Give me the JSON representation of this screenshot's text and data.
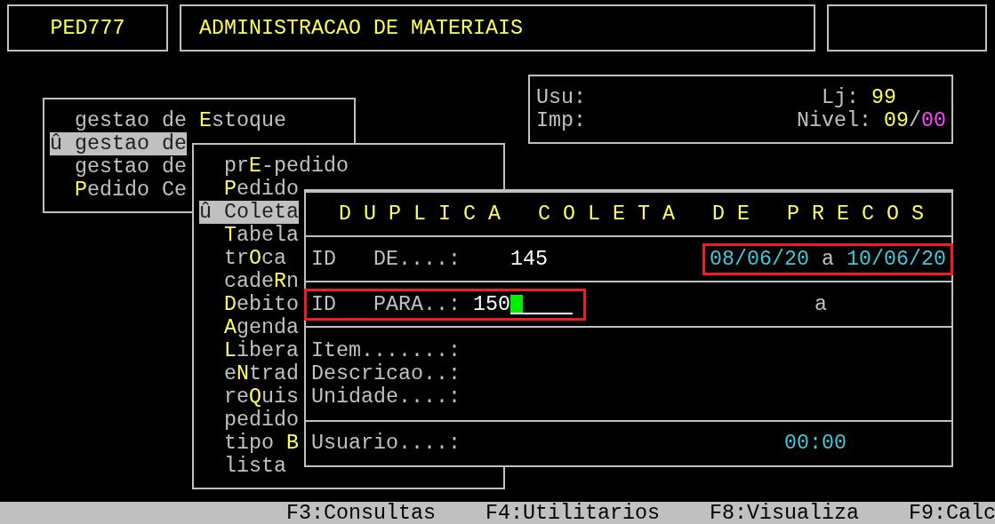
{
  "header": {
    "program_code": "PED777",
    "system_title": "ADMINISTRACAO DE MATERIAIS"
  },
  "info": {
    "user_label": "Usu:",
    "printer_label": "Imp:",
    "store_label": "Lj:",
    "store_value": "99",
    "level_label": "Nivel:",
    "level_value_primary": "09",
    "level_separator": "/",
    "level_value_secondary": "00"
  },
  "main_menu": {
    "items": [
      {
        "label": "gestao de **E**stoque",
        "selected": false
      },
      {
        "marker": "û",
        "label": "gestao de",
        "selected": true
      },
      {
        "label": "gestao de",
        "selected": false
      },
      {
        "label": "**P**edido Ce",
        "selected": false
      }
    ]
  },
  "sub_menu": {
    "items": [
      {
        "label": "pr**E**-pedido",
        "selected": false
      },
      {
        "label": "**P**edido",
        "selected": false
      },
      {
        "marker": "û",
        "label": "Coleta",
        "selected": true
      },
      {
        "label": "**T**abela",
        "selected": false
      },
      {
        "label": "tr**O**ca",
        "selected": false
      },
      {
        "label": "cade**R**n",
        "selected": false
      },
      {
        "label": "**D**ebito",
        "selected": false
      },
      {
        "label": "**A**genda",
        "selected": false
      },
      {
        "label": "**L**ibera",
        "selected": false
      },
      {
        "label": "e**N**trad",
        "selected": false
      },
      {
        "label": "re**Q**uis",
        "selected": false
      },
      {
        "label": "pedido",
        "selected": false
      },
      {
        "label": "tipo **B**",
        "selected": false
      },
      {
        "label": "lista",
        "selected": false
      }
    ]
  },
  "dialog": {
    "title": "D U P L I C A   C O L E T A   D E   P R E C O S",
    "source": {
      "label": "ID   DE....:",
      "value": "145",
      "date_from": "08/06/20",
      "date_separator": "a",
      "date_to": "10/06/20",
      "highlighted": true
    },
    "target": {
      "label": "ID   PARA..:",
      "value": "150",
      "date_separator": "a",
      "highlighted": true
    },
    "fields": [
      {
        "label": "Item.......:"
      },
      {
        "label": "Descricao..:"
      },
      {
        "label": "Unidade....:"
      }
    ],
    "user": {
      "label": "Usuario....:",
      "time": "00:00"
    }
  },
  "status_bar": [
    "F3:Consultas",
    "F4:Utilitarios",
    "F8:Visualiza",
    "F9:Calc"
  ]
}
